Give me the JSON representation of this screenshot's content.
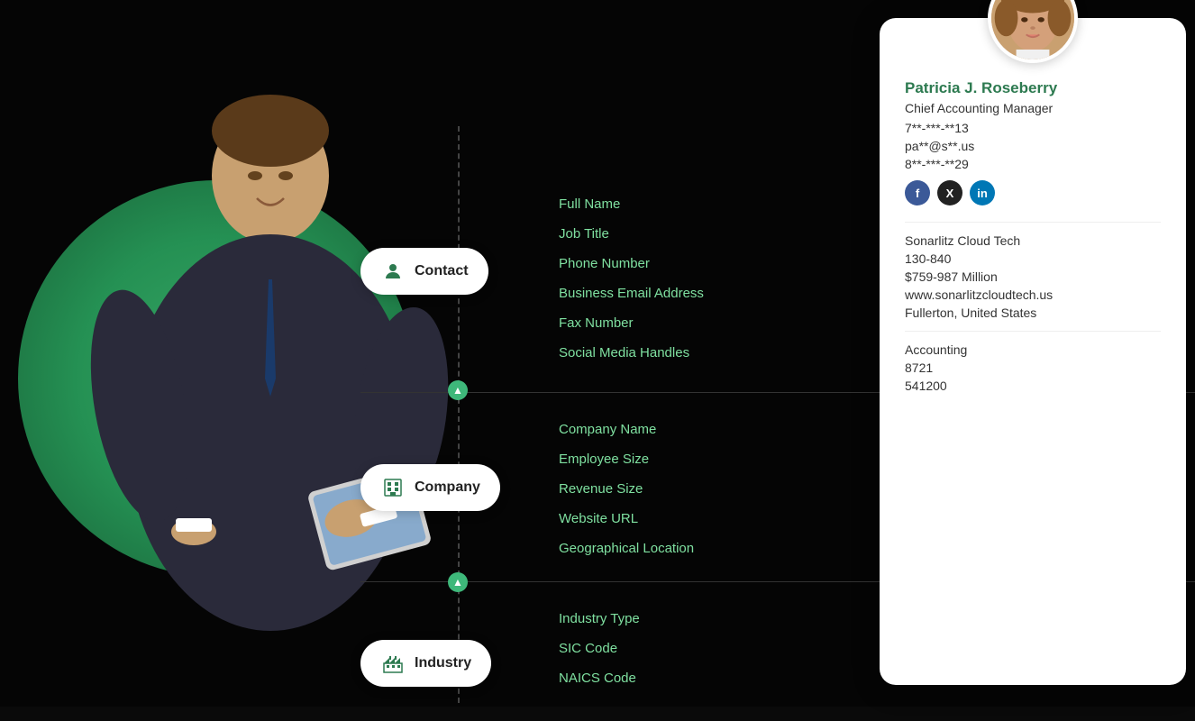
{
  "background": {
    "color": "#0a0a0a"
  },
  "badges": {
    "contact": {
      "label": "Contact",
      "icon": "person-icon"
    },
    "company": {
      "label": "Company",
      "icon": "building-icon"
    },
    "industry": {
      "label": "Industry",
      "icon": "factory-icon"
    }
  },
  "contact_fields": [
    "Full Name",
    "Job Title",
    "Phone Number",
    "Business Email Address",
    "Fax Number",
    "Social Media Handles"
  ],
  "company_fields": [
    "Company Name",
    "Employee Size",
    "Revenue Size",
    "Website URL",
    "Geographical Location"
  ],
  "industry_fields": [
    "Industry Type",
    "SIC Code",
    "NAICS Code"
  ],
  "profile": {
    "name": "Patricia J. Roseberry",
    "title": "Chief Accounting Manager",
    "phone": "7**-***-**13",
    "email": "pa**@s**.us",
    "fax": "8**-***-**29",
    "social": {
      "fb_label": "f",
      "x_label": "X",
      "li_label": "in"
    },
    "company_name": "Sonarlitz Cloud Tech",
    "employee_size": "130-840",
    "revenue": "$759-987 Million",
    "website": "www.sonarlitzcloudtech.us",
    "location": "Fullerton, United States",
    "industry_type": "Accounting",
    "sic_code": "8721",
    "naics_code": "541200"
  }
}
